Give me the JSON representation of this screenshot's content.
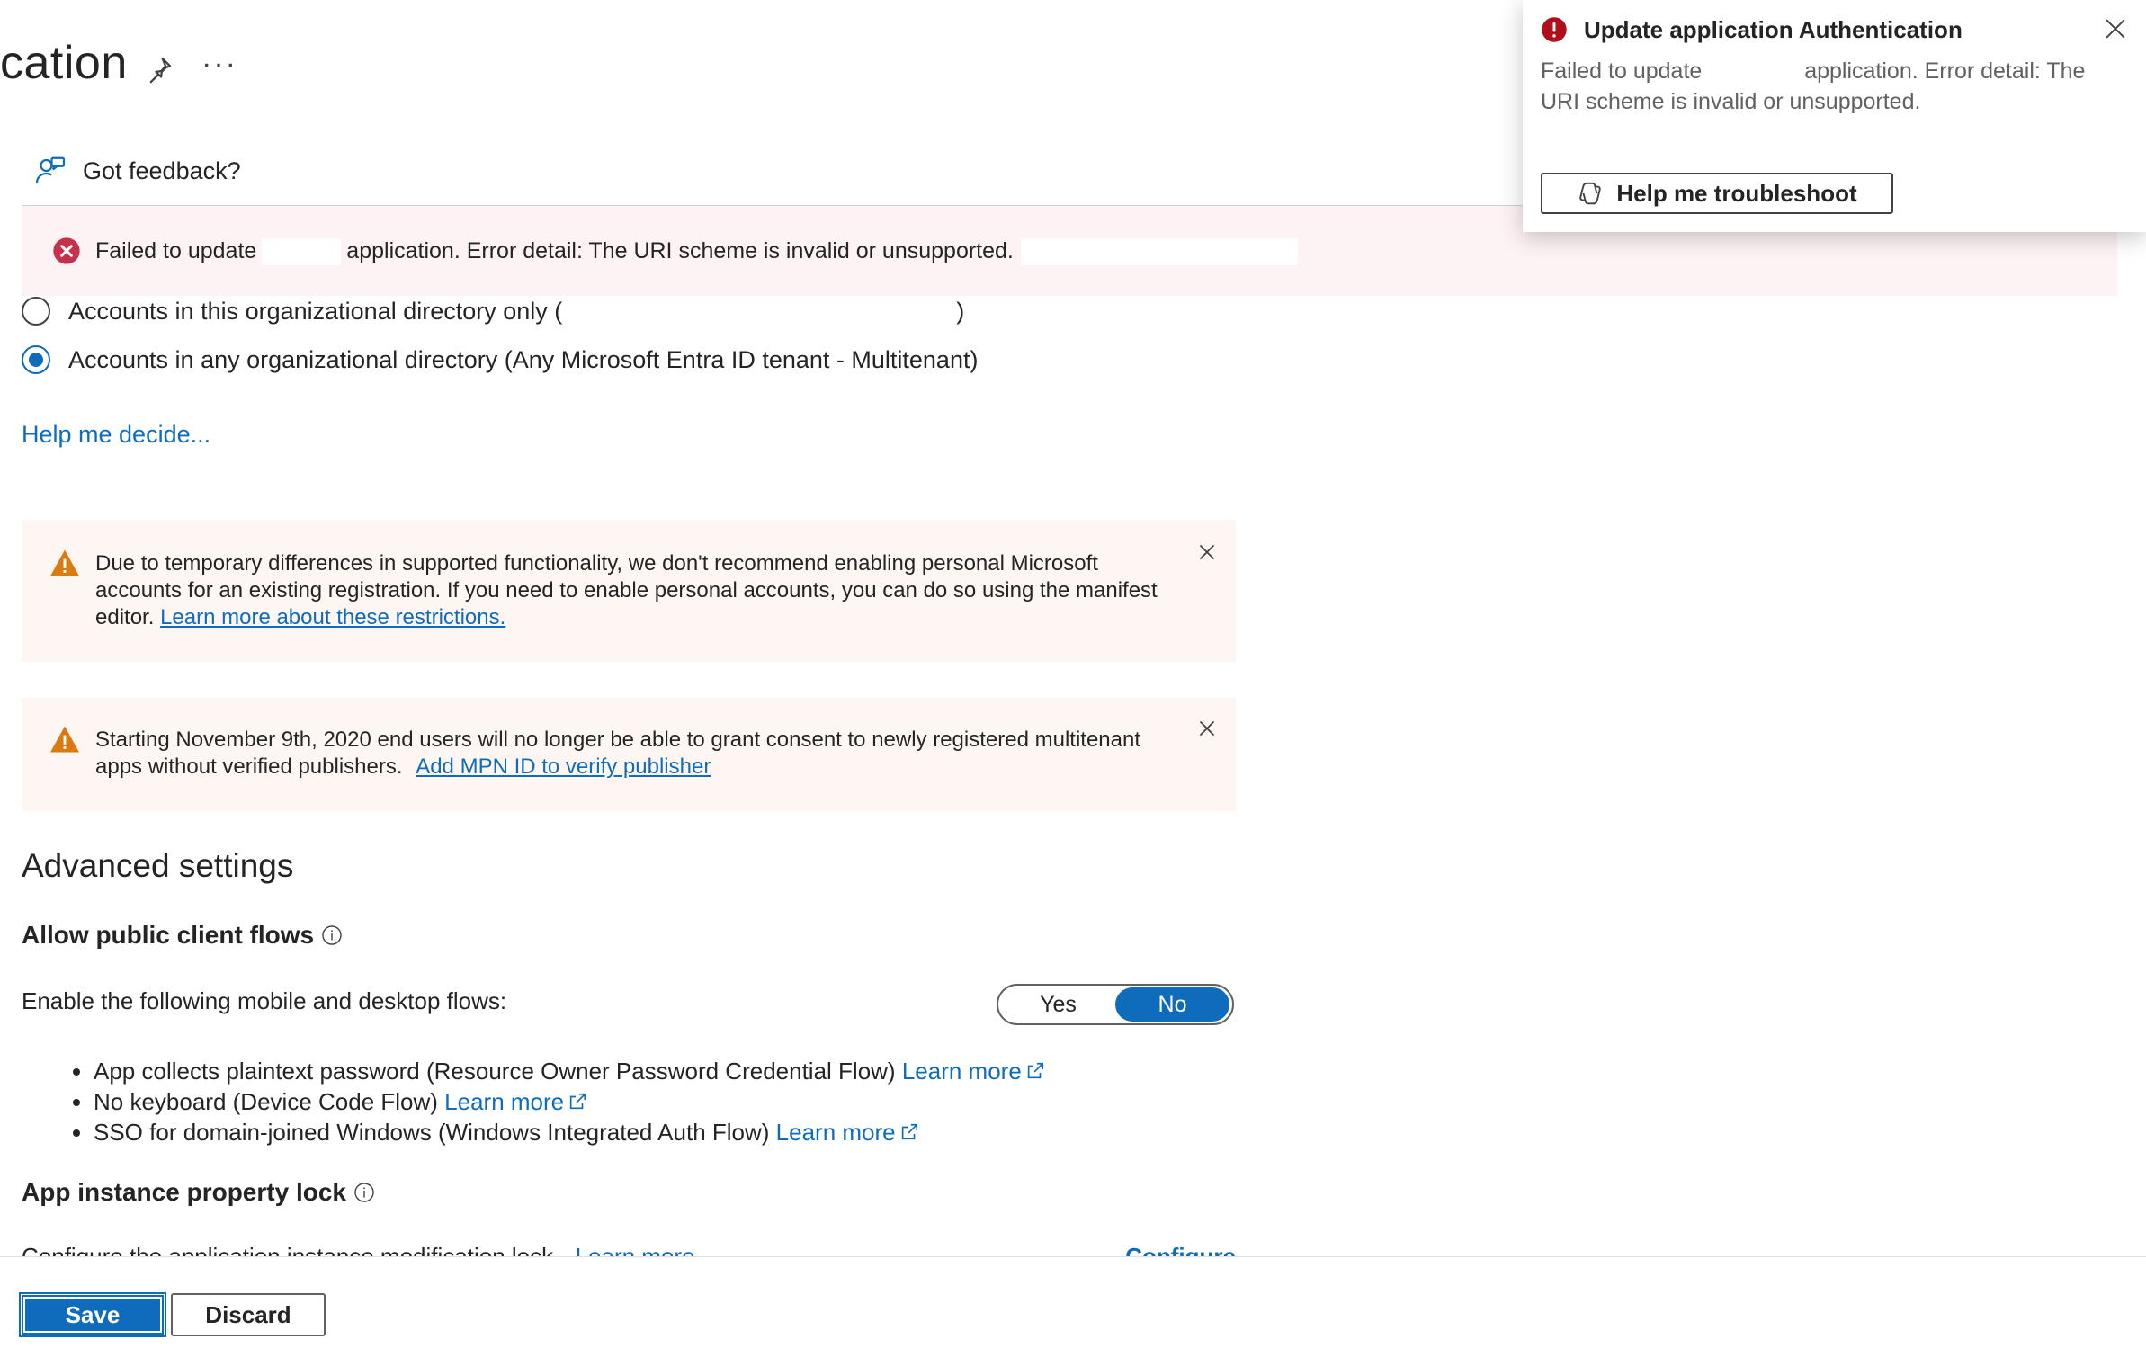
{
  "header": {
    "title": "cation",
    "more_label": "···"
  },
  "feedback": {
    "label": "Got feedback?"
  },
  "error_banner": {
    "prefix": "Failed to update",
    "suffix": "application. Error detail: The URI scheme is invalid or unsupported."
  },
  "account_types": {
    "options": [
      {
        "label_start": "Accounts in this organizational directory only (",
        "label_end": ")",
        "selected": false
      },
      {
        "label": "Accounts in any organizational directory (Any Microsoft Entra ID tenant - Multitenant)",
        "selected": true
      }
    ],
    "help_link": "Help me decide..."
  },
  "warnings": [
    {
      "text": "Due to temporary differences in supported functionality, we don't recommend enabling personal Microsoft accounts for an existing registration. If you need to enable personal accounts, you can do so using the manifest editor.",
      "link": "Learn more about these restrictions."
    },
    {
      "text": "Starting November 9th, 2020 end users will no longer be able to grant consent to newly registered multitenant apps without verified publishers.",
      "link": "Add MPN ID to verify publisher"
    }
  ],
  "advanced": {
    "heading": "Advanced settings",
    "public_client_flows": {
      "label": "Allow public client flows",
      "enable_label": "Enable the following mobile and desktop flows:",
      "toggle": {
        "yes": "Yes",
        "no": "No",
        "selected": "No"
      },
      "flows": [
        {
          "text": "App collects plaintext password (Resource Owner Password Credential Flow)",
          "link": "Learn more"
        },
        {
          "text": "No keyboard (Device Code Flow)",
          "link": "Learn more"
        },
        {
          "text": "SSO for domain-joined Windows (Windows Integrated Auth Flow)",
          "link": "Learn more"
        }
      ]
    },
    "property_lock": {
      "label": "App instance property lock",
      "description": "Configure the application instance modification lock.",
      "learn_more": "Learn more",
      "configure": "Configure"
    }
  },
  "footer": {
    "save": "Save",
    "discard": "Discard"
  },
  "toast": {
    "title": "Update application Authentication",
    "message_prefix": "Failed to update",
    "message_suffix": "application. Error detail: The URI scheme is invalid or unsupported.",
    "button": "Help me troubleshoot"
  },
  "colors": {
    "accent": "#0f6cbd",
    "error": "#c4314b",
    "warning": "#da7b11",
    "error_bg": "#fdf3f4",
    "warning_bg": "#fdf6f3"
  }
}
